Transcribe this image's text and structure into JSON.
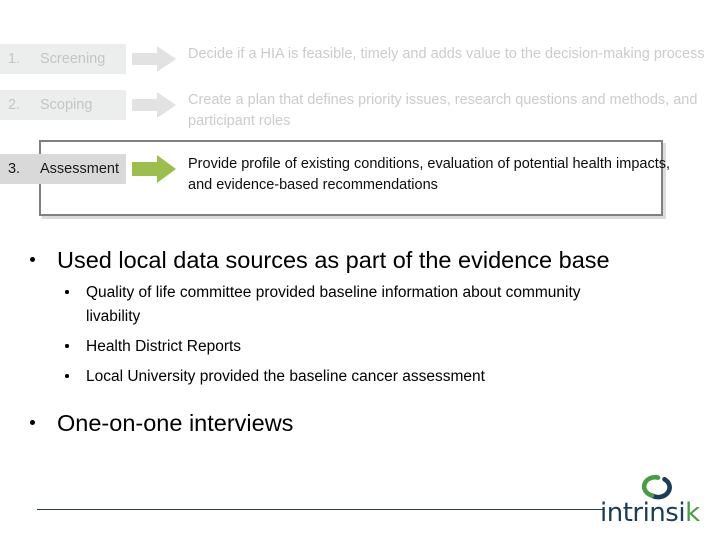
{
  "slide": {
    "process": {
      "steps": [
        {
          "number": "1.",
          "name": "Screening",
          "description": "Decide if a HIA is feasible, timely and adds value to the decision-making process",
          "state": "faded",
          "arrow_icon": "right-arrow-icon",
          "arrow_color": "#e0e0e0"
        },
        {
          "number": "2.",
          "name": "Scoping",
          "description": "Create a plan that defines priority issues, research questions and methods, and participant roles",
          "state": "faded",
          "arrow_icon": "right-arrow-icon",
          "arrow_color": "#e0e0e0"
        },
        {
          "number": "3.",
          "name": "Assessment",
          "description": "Provide profile of existing conditions, evaluation of potential health impacts, and evidence-based recommendations",
          "state": "active",
          "arrow_icon": "right-arrow-icon",
          "arrow_color": "#9cbe4e"
        }
      ],
      "highlight_border_color": "#808080"
    },
    "bullets": [
      {
        "level": 1,
        "text": "Used local data sources as part of the evidence base",
        "children": [
          "Quality of life committee provided baseline information about community livability",
          "Health District Reports",
          "Local University provided the baseline cancer assessment"
        ]
      },
      {
        "level": 1,
        "text": "One-on-one interviews",
        "children": []
      }
    ],
    "footer": {
      "rule_color": "#203e52",
      "logo": {
        "wordmark_main": "intrinsi",
        "wordmark_accent": "k",
        "mark_icon": "intrinsik-ring-icon",
        "navy": "#1d3c55",
        "green": "#4a9a46"
      }
    }
  }
}
